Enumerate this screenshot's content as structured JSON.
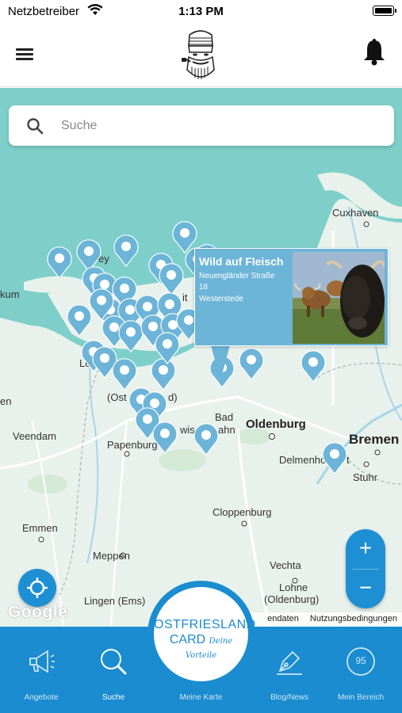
{
  "status_bar": {
    "carrier": "Netzbetreiber",
    "time": "1:13 PM"
  },
  "header": {
    "menu_icon": "hamburger-icon",
    "logo": "bearded-man-logo",
    "bell_icon": "bell-icon"
  },
  "search": {
    "placeholder": "Suche",
    "icon": "search-icon"
  },
  "map": {
    "labels": {
      "cuxhaven": "Cuxhaven",
      "kum": "kum",
      "ey": "ey",
      "it": "it",
      "osw": "(Ost",
      "osw2": "d)",
      "leer_fragment": "Le",
      "en": "en",
      "veendam": "Veendam",
      "papenburg": "Papenburg",
      "bad": "Bad",
      "zwischen": "wisc",
      "ahn": "ahn",
      "oldenburg": "Oldenburg",
      "bremen": "Bremen",
      "delmenhorst": "Delmenho",
      "delmenhorst_end": "t",
      "stuhr": "Stuhr",
      "emmen": "Emmen",
      "cloppenburg": "Cloppenburg",
      "meppen": "Meppen",
      "vechta": "Vechta",
      "lohne": "Lohne",
      "lohne2": "(Oldenburg)",
      "lingen": "Lingen (Ems)"
    },
    "popup": {
      "title": "Wild auf Fleisch",
      "street": "Neuengländer Straße",
      "number": "18",
      "city": "Westerstede"
    },
    "google": "Google",
    "attribution": {
      "data": "endaten",
      "terms": "Nutzungsbedingungen"
    },
    "zoom_in": "+",
    "zoom_out": "−"
  },
  "tabs": {
    "offers": "Angebote",
    "search": "Suche",
    "card": "Meine Karte",
    "blog": "Blog/News",
    "account": "Mein Bereich",
    "account_badge": "95"
  },
  "card_logo": {
    "line1": "OSTFRIESLAND",
    "line2": "CARD",
    "script": "Deine Vorteile"
  },
  "colors": {
    "sea": "#7ecfca",
    "land": "#e9f1ec",
    "pin": "#6cb4d8",
    "accent": "#1a8ccf"
  }
}
